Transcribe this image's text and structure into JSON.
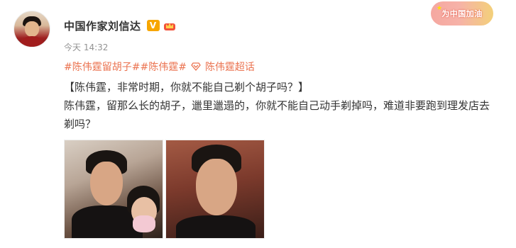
{
  "author": {
    "name": "中国作家刘信达",
    "vip_label": "V",
    "avatar_icon": "author-avatar"
  },
  "post": {
    "time": "今天 14:32",
    "topics": [
      "#陈伟霆留胡子#",
      "#陈伟霆#"
    ],
    "super_topic": "陈伟霆超话",
    "headline": "【陈伟霆，非常时期，你就不能自己剃个胡子吗？】",
    "body": "陈伟霆，留那么长的胡子，邋里邋遢的，你就不能自己动手剃掉吗，难道非要跑到理发店去剃吗？",
    "images": [
      "photo-selfie-with-child",
      "photo-selfie-closeup"
    ]
  },
  "banner": {
    "text": "为中国加油"
  },
  "colors": {
    "topic": "#eb7350",
    "name": "#333333",
    "time": "#939393",
    "vip": "#f7a600"
  }
}
